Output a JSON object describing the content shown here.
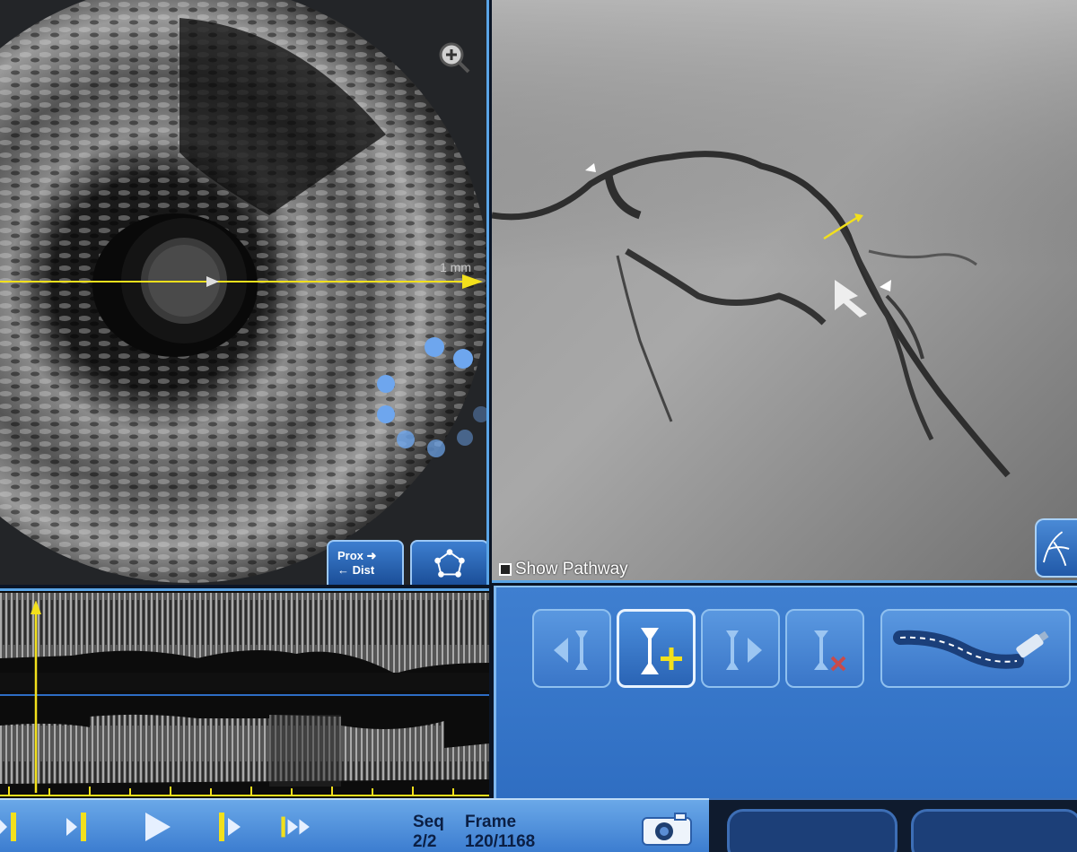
{
  "ivus": {
    "scale_label": "1 mm",
    "prox_label": "Prox",
    "dist_label": "Dist"
  },
  "angio": {
    "show_pathway_label": "Show Pathway"
  },
  "playback": {
    "seq_label": "Seq",
    "seq_value": "2/2",
    "frame_label": "Frame",
    "frame_value": "120/1168"
  },
  "icons": {
    "zoom": "zoom-in-icon",
    "prox_dist": "prox-dist-arrows-icon",
    "shape": "polygon-trace-icon",
    "vessel": "vessel-tree-icon",
    "marker_prev": "marker-previous-icon",
    "marker_add": "marker-add-icon",
    "marker_next": "marker-next-icon",
    "marker_delete": "marker-delete-icon",
    "pullback_path": "pullback-path-icon",
    "camera": "camera-icon"
  },
  "colors": {
    "accent_blue": "#5aa4e6",
    "marker_yellow": "#f2e01c"
  }
}
